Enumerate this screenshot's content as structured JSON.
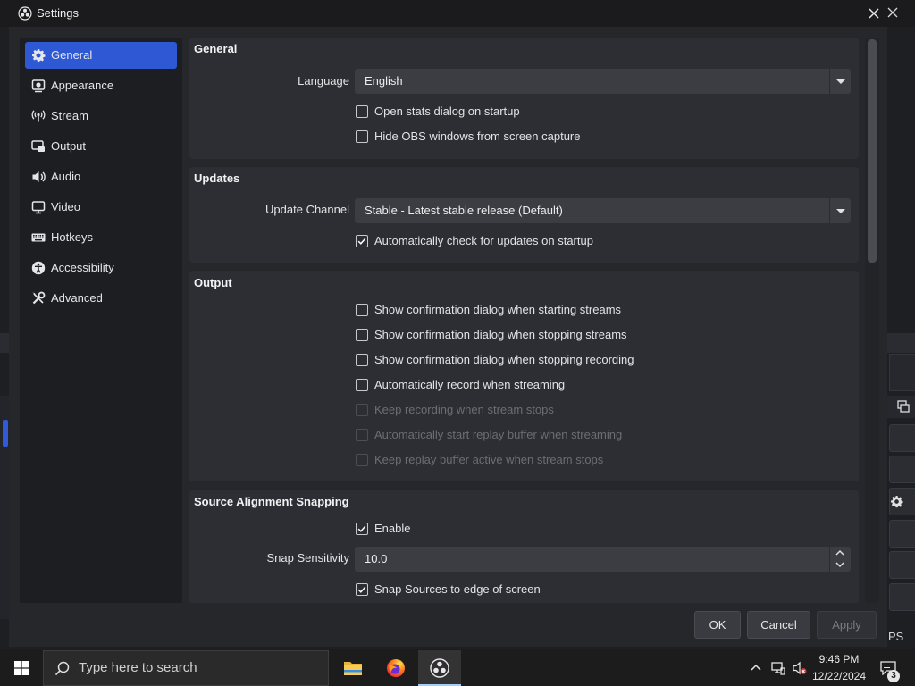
{
  "window": {
    "title": "Settings",
    "logo_icon": "obs-logo-icon",
    "close_icon": "close-icon"
  },
  "colors": {
    "accent_selected": "#2e58d4",
    "dialog_background": "#26272b",
    "group_background": "#2d2e33",
    "text": "#e3e3e6",
    "text_disabled": "#6c6d73"
  },
  "sidebar": {
    "items": [
      {
        "label": "General",
        "icon": "gear-icon",
        "selected": true
      },
      {
        "label": "Appearance",
        "icon": "appearance-icon",
        "selected": false
      },
      {
        "label": "Stream",
        "icon": "antenna-icon",
        "selected": false
      },
      {
        "label": "Output",
        "icon": "output-icon",
        "selected": false
      },
      {
        "label": "Audio",
        "icon": "speaker-icon",
        "selected": false
      },
      {
        "label": "Video",
        "icon": "monitor-icon",
        "selected": false
      },
      {
        "label": "Hotkeys",
        "icon": "keyboard-icon",
        "selected": false
      },
      {
        "label": "Accessibility",
        "icon": "accessibility-icon",
        "selected": false
      },
      {
        "label": "Advanced",
        "icon": "tools-icon",
        "selected": false
      }
    ]
  },
  "general": {
    "title": "General",
    "language_label": "Language",
    "language_value": "English",
    "checkboxes": [
      {
        "label": "Open stats dialog on startup",
        "checked": false,
        "enabled": true
      },
      {
        "label": "Hide OBS windows from screen capture",
        "checked": false,
        "enabled": true
      }
    ]
  },
  "updates": {
    "title": "Updates",
    "channel_label": "Update Channel",
    "channel_value": "Stable - Latest stable release (Default)",
    "checkboxes": [
      {
        "label": "Automatically check for updates on startup",
        "checked": true,
        "enabled": true
      }
    ]
  },
  "output": {
    "title": "Output",
    "checkboxes": [
      {
        "label": "Show confirmation dialog when starting streams",
        "checked": false,
        "enabled": true
      },
      {
        "label": "Show confirmation dialog when stopping streams",
        "checked": false,
        "enabled": true
      },
      {
        "label": "Show confirmation dialog when stopping recording",
        "checked": false,
        "enabled": true
      },
      {
        "label": "Automatically record when streaming",
        "checked": false,
        "enabled": true
      },
      {
        "label": "Keep recording when stream stops",
        "checked": false,
        "enabled": false
      },
      {
        "label": "Automatically start replay buffer when streaming",
        "checked": false,
        "enabled": false
      },
      {
        "label": "Keep replay buffer active when stream stops",
        "checked": false,
        "enabled": false
      }
    ]
  },
  "snapping": {
    "title": "Source Alignment Snapping",
    "enable": {
      "label": "Enable",
      "checked": true,
      "enabled": true
    },
    "sensitivity_label": "Snap Sensitivity",
    "sensitivity_value": "10.0",
    "snap_edge": {
      "label": "Snap Sources to edge of screen",
      "checked": true,
      "enabled": true
    }
  },
  "buttons": {
    "ok": "OK",
    "cancel": "Cancel",
    "apply": "Apply",
    "apply_enabled": false
  },
  "taskbar": {
    "start_icon": "windows-logo-icon",
    "search_placeholder": "Type here to search",
    "apps": [
      {
        "icon": "file-explorer-icon",
        "active": false
      },
      {
        "icon": "firefox-icon",
        "active": false
      },
      {
        "icon": "obs-icon",
        "active": true
      }
    ],
    "tray_icons": [
      "chevron-up-icon",
      "network-icon",
      "volume-muted-icon"
    ],
    "clock_time": "9:46 PM",
    "clock_date": "12/22/2024",
    "notification_count": "3"
  },
  "background_window": {
    "status_text": "PS"
  }
}
